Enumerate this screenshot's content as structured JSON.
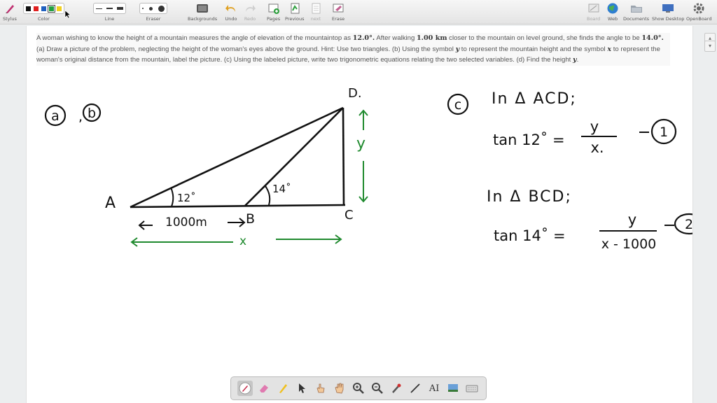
{
  "toolbar": {
    "stylus_label": "Stylus",
    "color_label": "Color",
    "line_label": "Line",
    "eraser_label": "Eraser",
    "backgrounds_label": "Backgrounds",
    "undo_label": "Undo",
    "redo_label": "Redo",
    "pages_label": "Pages",
    "previous_label": "Previous",
    "next_label": "next",
    "erase_label": "Erase",
    "colors": [
      "#111111",
      "#e02020",
      "#2060c0",
      "#20a040",
      "#f0d020"
    ],
    "selected_color_index": 3
  },
  "right_toolbar": {
    "board_label": "Board",
    "web_label": "Web",
    "documents_label": "Documents",
    "show_desktop_label": "Show Desktop",
    "openboard_label": "OpenBoard"
  },
  "problem": {
    "p1": "A woman wishing to know the height of a mountain measures the angle of elevation of the mountaintop as ",
    "angle1": "12.0°.",
    "p2": " After walking ",
    "distance": "1.00 km",
    "p3": " closer to the mountain on level ground, she finds the angle to be ",
    "angle2": "14.0°.",
    "p4": " (a) Draw a picture of the problem, neglecting the height of the woman's eyes above the ground. Hint: Use two triangles. (b) Using the symbol ",
    "sym_y": "y",
    "p5": " to represent the mountain height and the symbol ",
    "sym_x": "x",
    "p6": " to represent the woman's original distance from the mountain, label the picture. (c) Using the labeled picture, write two trigonometric equations relating the two selected variables. (d) Find the height ",
    "sym_y2": "y",
    "p7": "."
  },
  "handwriting": {
    "part_a": "a",
    "comma": ",",
    "part_b": "b",
    "point_a": "A",
    "point_b": "B",
    "point_c": "C",
    "point_d": "D.",
    "angle_12": "12˚",
    "angle_14": "14˚",
    "dist_label": "1000m",
    "x_label": "x",
    "y_label": "y",
    "part_c": "c",
    "tri1": "In Δ ACD;",
    "eq1_lhs": "tan 12˚ =",
    "eq1_num": "y",
    "eq1_den": "x.",
    "eq1_tag": "1",
    "tri2": "In Δ BCD;",
    "eq2_lhs": "tan 14˚ =",
    "eq2_num": "y",
    "eq2_den": "x - 1000",
    "eq2_tag": "2"
  }
}
